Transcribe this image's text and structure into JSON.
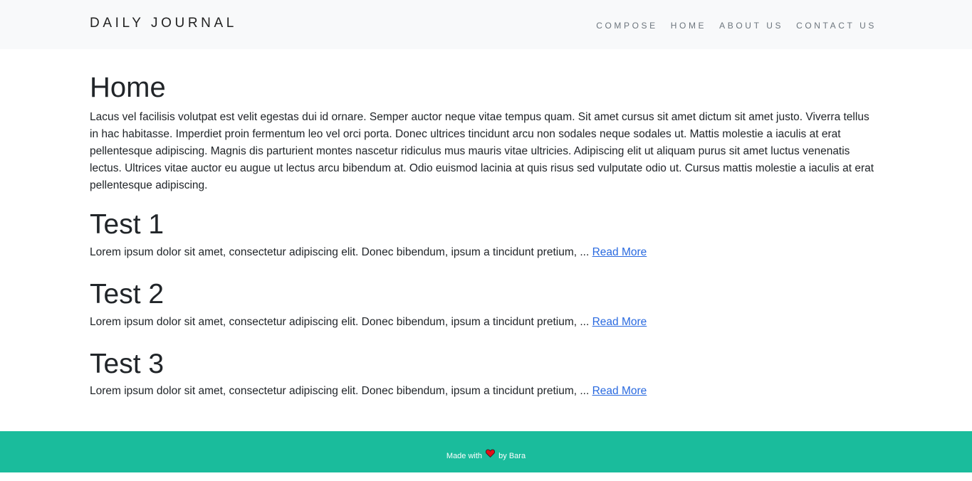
{
  "navbar": {
    "brand": "DAILY JOURNAL",
    "links": [
      "COMPOSE",
      "HOME",
      "ABOUT US",
      "CONTACT US"
    ]
  },
  "main": {
    "title": "Home",
    "intro": "Lacus vel facilisis volutpat est velit egestas dui id ornare. Semper auctor neque vitae tempus quam. Sit amet cursus sit amet dictum sit amet justo. Viverra tellus in hac habitasse. Imperdiet proin fermentum leo vel orci porta. Donec ultrices tincidunt arcu non sodales neque sodales ut. Mattis molestie a iaculis at erat pellentesque adipiscing. Magnis dis parturient montes nascetur ridiculus mus mauris vitae ultricies. Adipiscing elit ut aliquam purus sit amet luctus venenatis lectus. Ultrices vitae auctor eu augue ut lectus arcu bibendum at. Odio euismod lacinia at quis risus sed vulputate odio ut. Cursus mattis molestie a iaculis at erat pellentesque adipiscing.",
    "posts": [
      {
        "title": "Test 1",
        "excerpt": "Lorem ipsum dolor sit amet, consectetur adipiscing elit. Donec bibendum, ipsum a tincidunt pretium, ...",
        "link_label": "Read More"
      },
      {
        "title": "Test 2",
        "excerpt": "Lorem ipsum dolor sit amet, consectetur adipiscing elit. Donec bibendum, ipsum a tincidunt pretium, ...",
        "link_label": "Read More"
      },
      {
        "title": "Test 3",
        "excerpt": "Lorem ipsum dolor sit amet, consectetur adipiscing elit. Donec bibendum, ipsum a tincidunt pretium, ...",
        "link_label": "Read More"
      }
    ]
  },
  "footer": {
    "prefix": "Made with",
    "icon": "heart-icon",
    "suffix": "by Bara"
  },
  "colors": {
    "navbar_bg": "#f8f9fa",
    "footer_bg": "#1abc9c",
    "link": "#2a6ae0",
    "heart": "#e0101a"
  }
}
